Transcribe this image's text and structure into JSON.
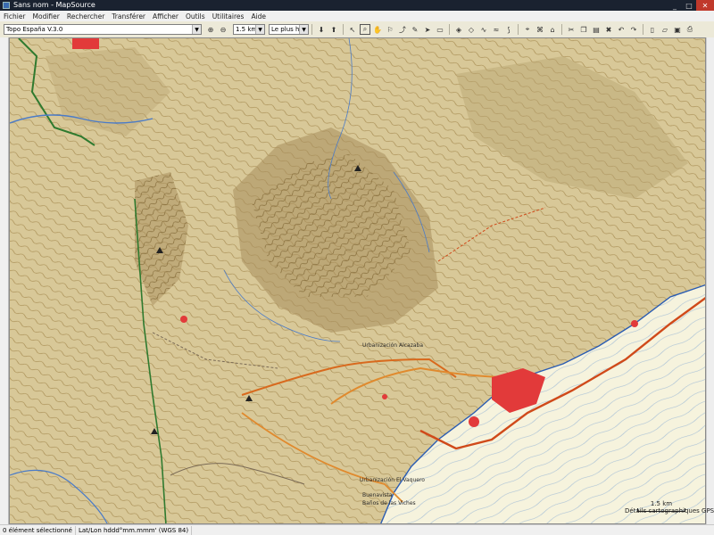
{
  "window": {
    "title": "Sans nom - MapSource",
    "controls": [
      "_",
      "□",
      "✕"
    ]
  },
  "menu": [
    "Fichier",
    "Modifier",
    "Rechercher",
    "Transférer",
    "Afficher",
    "Outils",
    "Utilitaires",
    "Aide"
  ],
  "toolbar": {
    "product": "Topo España V.3.0",
    "zoom_level": "1.5 km",
    "detail": "Le plus haut"
  },
  "map": {
    "scale_label": "1.5 km",
    "credit": "Détails cartographiques GPS",
    "labels": {
      "town_lower": "Urbanización Alcazaba",
      "town_coast": "Urbanización El Vaquero",
      "town_coast2": "Buenavista",
      "coast_town": "Baños de las Viches"
    }
  },
  "status": {
    "selection": "0 élément sélectionné",
    "coords": "Lat/Lon hddd°mm.mmm' (WGS 84)"
  },
  "colors": {
    "terrain": "#cdbb8e",
    "sea": "#f4f1d8",
    "contour": "#8a6a2a",
    "road": "#d86a1e",
    "town": "#e23a3a",
    "water": "#4a7bc8",
    "forest_line": "#2f7a2f"
  }
}
